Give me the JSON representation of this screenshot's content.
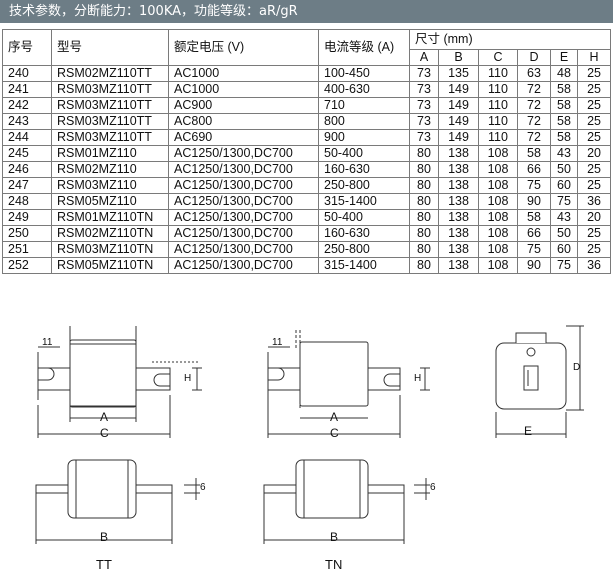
{
  "header": {
    "title": "技术参数，分断能力：100KA，功能等级：aR/gR"
  },
  "table": {
    "columns": {
      "seq": "序号",
      "model": "型号",
      "voltage": "额定电压 (V)",
      "current": "电流等级 (A)",
      "dims": "尺寸 (mm)",
      "dim_letters": [
        "A",
        "B",
        "C",
        "D",
        "E",
        "H"
      ]
    },
    "rows": [
      [
        "240",
        "RSM02MZ110TT",
        "AC1000",
        "100-450",
        "73",
        "135",
        "110",
        "63",
        "48",
        "25"
      ],
      [
        "241",
        "RSM03MZ110TT",
        "AC1000",
        "400-630",
        "73",
        "149",
        "110",
        "72",
        "58",
        "25"
      ],
      [
        "242",
        "RSM03MZ110TT",
        "AC900",
        "710",
        "73",
        "149",
        "110",
        "72",
        "58",
        "25"
      ],
      [
        "243",
        "RSM03MZ110TT",
        "AC800",
        "800",
        "73",
        "149",
        "110",
        "72",
        "58",
        "25"
      ],
      [
        "244",
        "RSM03MZ110TT",
        "AC690",
        "900",
        "73",
        "149",
        "110",
        "72",
        "58",
        "25"
      ],
      [
        "245",
        "RSM01MZ110",
        "AC1250/1300,DC700",
        "50-400",
        "80",
        "138",
        "108",
        "58",
        "43",
        "20"
      ],
      [
        "246",
        "RSM02MZ110",
        "AC1250/1300,DC700",
        "160-630",
        "80",
        "138",
        "108",
        "66",
        "50",
        "25"
      ],
      [
        "247",
        "RSM03MZ110",
        "AC1250/1300,DC700",
        "250-800",
        "80",
        "138",
        "108",
        "75",
        "60",
        "25"
      ],
      [
        "248",
        "RSM05MZ110",
        "AC1250/1300,DC700",
        "315-1400",
        "80",
        "138",
        "108",
        "90",
        "75",
        "36"
      ],
      [
        "249",
        "RSM01MZ110TN",
        "AC1250/1300,DC700",
        "50-400",
        "80",
        "138",
        "108",
        "58",
        "43",
        "20"
      ],
      [
        "250",
        "RSM02MZ110TN",
        "AC1250/1300,DC700",
        "160-630",
        "80",
        "138",
        "108",
        "66",
        "50",
        "25"
      ],
      [
        "251",
        "RSM03MZ110TN",
        "AC1250/1300,DC700",
        "250-800",
        "80",
        "138",
        "108",
        "75",
        "60",
        "25"
      ],
      [
        "252",
        "RSM05MZ110TN",
        "AC1250/1300,DC700",
        "315-1400",
        "80",
        "138",
        "108",
        "90",
        "75",
        "36"
      ]
    ]
  },
  "drawings": {
    "label_11": "11",
    "label_A": "A",
    "label_B": "B",
    "label_C": "C",
    "label_D": "D",
    "label_E": "E",
    "label_H": "H",
    "label_6": "6",
    "caption_tt": "TT",
    "caption_tn": "TN"
  }
}
